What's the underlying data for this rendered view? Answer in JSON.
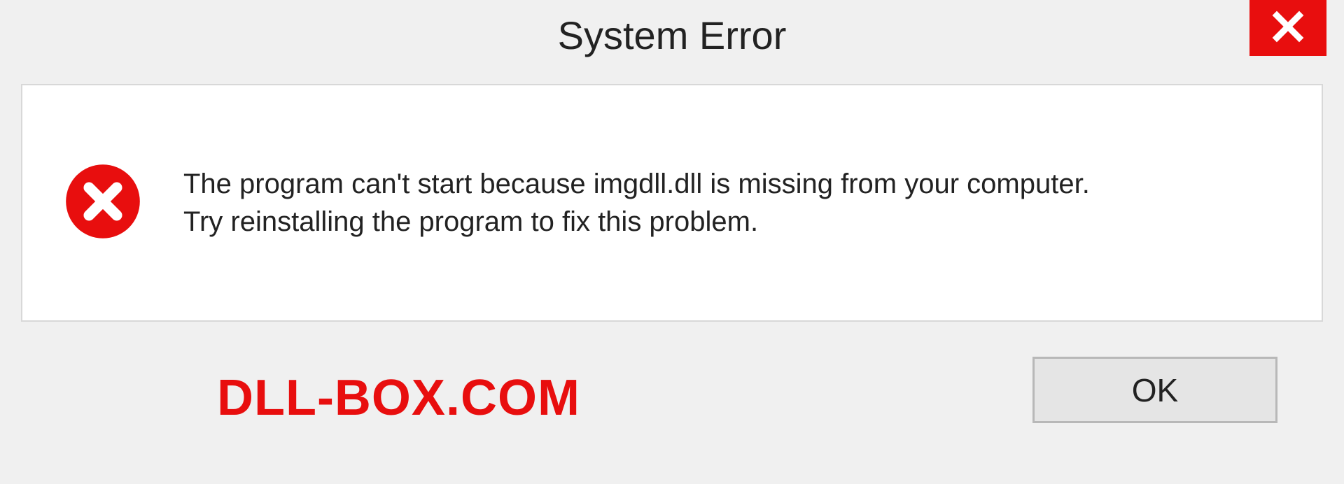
{
  "titlebar": {
    "title": "System Error"
  },
  "message": {
    "line1": "The program can't start because imgdll.dll is missing from your computer.",
    "line2": "Try reinstalling the program to fix this problem."
  },
  "footer": {
    "watermark": "DLL-BOX.COM",
    "ok_label": "OK"
  },
  "icons": {
    "close": "close-icon",
    "error": "error-circle-x-icon"
  },
  "colors": {
    "accent_red": "#e80e0e",
    "panel_bg": "#ffffff",
    "window_bg": "#f0f0f0"
  }
}
